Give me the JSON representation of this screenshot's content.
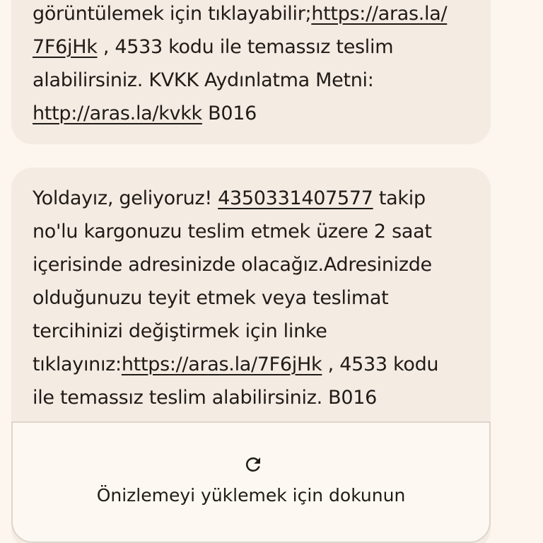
{
  "messages": {
    "previous": {
      "lines": [
        {
          "pre": "görüntülemek için tıklayabilir;",
          "link": "https://aras.la/",
          "post": ""
        },
        {
          "pre": "",
          "link": "7F6jHk",
          "post": " , 4533 kodu ile temassız teslim"
        },
        {
          "pre": "alabilirsiniz. KVKK Aydınlatma Metni:",
          "link": "",
          "post": ""
        },
        {
          "pre": "",
          "link": "http://aras.la/kvkk",
          "post": " B016"
        }
      ]
    },
    "latest": {
      "lines": [
        {
          "pre": "Yoldayız, geliyoruz! ",
          "link": "4350331407577",
          "post": " takip"
        },
        {
          "pre": "no'lu kargonuzu teslim etmek üzere 2 saat",
          "link": "",
          "post": ""
        },
        {
          "pre": "içerisinde adresinizde olacağız.Adresinizde",
          "link": "",
          "post": ""
        },
        {
          "pre": "olduğunuzu teyit etmek veya teslimat",
          "link": "",
          "post": ""
        },
        {
          "pre": "tercihinizi değiştirmek için linke",
          "link": "",
          "post": ""
        },
        {
          "pre": "tıklayınız:",
          "link": "https://aras.la/7F6jHk",
          "post": " , 4533 kodu"
        },
        {
          "pre": "ile temassız teslim alabilirsiniz. B016",
          "link": "",
          "post": ""
        }
      ]
    }
  },
  "link_preview": {
    "icon": "refresh-icon",
    "label": "Önizlemeyi yüklemek için dokunun"
  }
}
